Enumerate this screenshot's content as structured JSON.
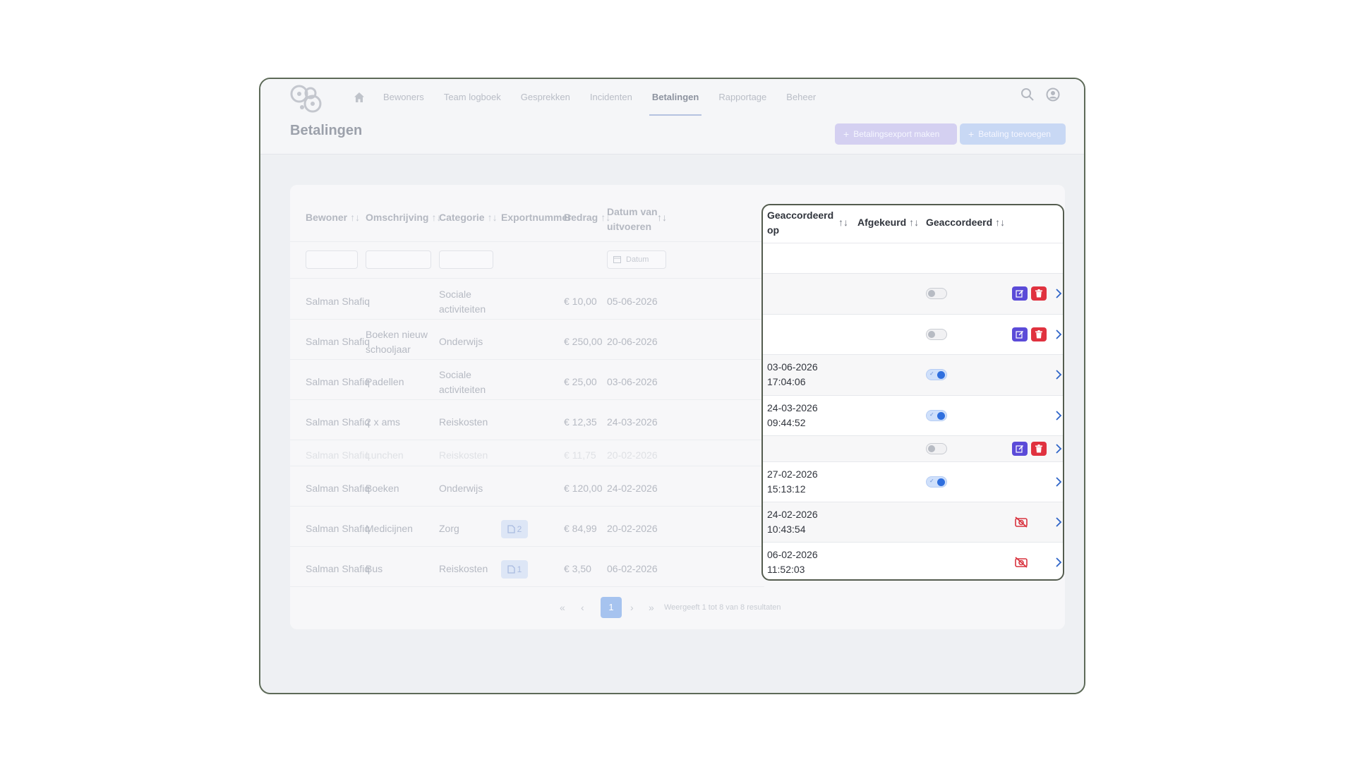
{
  "app": {
    "nav": {
      "items": [
        "Bewoners",
        "Team logboek",
        "Gesprekken",
        "Incidenten",
        "Betalingen",
        "Rapportage",
        "Beheer"
      ],
      "active": "Betalingen"
    },
    "page_title": "Betalingen",
    "buttons": {
      "export": "Betalingsexport maken",
      "add": "Betaling toevoegen"
    }
  },
  "table": {
    "columns": {
      "bewoner": "Bewoner",
      "omschrijving": "Omschrijving",
      "categorie": "Categorie",
      "exportnummer": "Exportnummer",
      "bedrag": "Bedrag",
      "datum": "Datum van uitvoeren",
      "geaccordeerd_op": "Geaccordeerd op",
      "afgekeurd": "Afgekeurd",
      "geaccordeerd": "Geaccordeerd"
    },
    "sort_icon": "↑↓",
    "date_placeholder": "Datum",
    "rows": [
      {
        "bewoner": "Salman Shafiq",
        "omschrijving": "",
        "categorie": "Sociale activiteiten",
        "export": "",
        "bedrag": "€ 10,00",
        "datum": "05-06-2026",
        "geaccordeerd_op": "",
        "approved": false,
        "editable": true
      },
      {
        "bewoner": "Salman Shafiq",
        "omschrijving": "Boeken nieuw schooljaar",
        "categorie": "Onderwijs",
        "export": "",
        "bedrag": "€ 250,00",
        "datum": "20-06-2026",
        "geaccordeerd_op": "",
        "approved": false,
        "editable": true
      },
      {
        "bewoner": "Salman Shafiq",
        "omschrijving": "Padellen",
        "categorie": "Sociale activiteiten",
        "export": "",
        "bedrag": "€ 25,00",
        "datum": "03-06-2026",
        "geaccordeerd_op": "03-06-2026 17:04:06",
        "approved": true,
        "editable": false
      },
      {
        "bewoner": "Salman Shafiq",
        "omschrijving": "2 x ams",
        "categorie": "Reiskosten",
        "export": "",
        "bedrag": "€ 12,35",
        "datum": "24-03-2026",
        "geaccordeerd_op": "24-03-2026 09:44:52",
        "approved": true,
        "editable": false
      },
      {
        "bewoner": "Salman Shafiq",
        "omschrijving": "Lunchen",
        "categorie": "Reiskosten",
        "export": "",
        "bedrag": "€ 11,75",
        "datum": "20-02-2026",
        "geaccordeerd_op": "",
        "approved": false,
        "editable": true
      },
      {
        "bewoner": "Salman Shafiq",
        "omschrijving": "Boeken",
        "categorie": "Onderwijs",
        "export": "",
        "bedrag": "€ 120,00",
        "datum": "24-02-2026",
        "geaccordeerd_op": "27-02-2026 15:13:12",
        "approved": true,
        "editable": false
      },
      {
        "bewoner": "Salman Shafiq",
        "omschrijving": "Medicijnen",
        "categorie": "Zorg",
        "export": "2",
        "bedrag": "€ 84,99",
        "datum": "20-02-2026",
        "geaccordeerd_op": "24-02-2026 10:43:54",
        "approved": null,
        "editable": false
      },
      {
        "bewoner": "Salman Shafiq",
        "omschrijving": "Bus",
        "categorie": "Reiskosten",
        "export": "1",
        "bedrag": "€ 3,50",
        "datum": "06-02-2026",
        "geaccordeerd_op": "06-02-2026 11:52:03",
        "approved": null,
        "editable": false
      }
    ]
  },
  "pagination": {
    "first": "«",
    "prev": "‹",
    "page": "1",
    "next": "›",
    "last": "»",
    "info": "Weergeeft 1 tot 8 van 8 resultaten"
  }
}
